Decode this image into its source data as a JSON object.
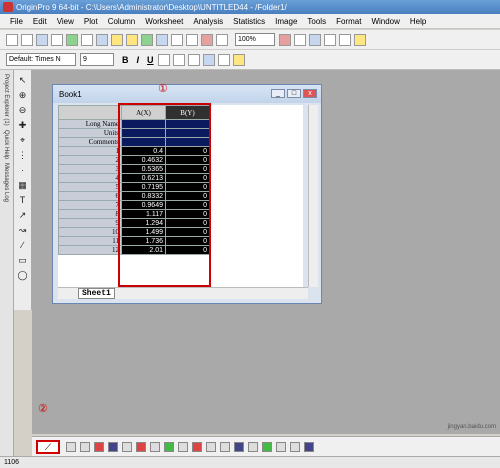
{
  "window": {
    "title": "OriginPro 9 64-bit - C:\\Users\\Administrator\\Desktop\\UNTITLED44 - /Folder1/"
  },
  "menu": [
    "File",
    "Edit",
    "View",
    "Plot",
    "Column",
    "Worksheet",
    "Analysis",
    "Statistics",
    "Image",
    "Tools",
    "Format",
    "Window",
    "Help"
  ],
  "toolbar": {
    "zoom": "100%",
    "font": "Default: Times N",
    "font_size": "9",
    "bold": "B",
    "italic": "I",
    "underline": "U"
  },
  "side_tabs": [
    "Project Explorer (1)",
    "Quick Help",
    "Messages Log"
  ],
  "book": {
    "title": "Book1",
    "columns": [
      "A(X)",
      "B(Y)"
    ],
    "row_labels": [
      "Long Name",
      "Units",
      "Comments"
    ],
    "rows": [
      {
        "n": "1",
        "a": "0.4",
        "b": "0"
      },
      {
        "n": "2",
        "a": "0.4632",
        "b": "0"
      },
      {
        "n": "3",
        "a": "0.5365",
        "b": "0"
      },
      {
        "n": "4",
        "a": "0.6213",
        "b": "0"
      },
      {
        "n": "5",
        "a": "0.7195",
        "b": "0"
      },
      {
        "n": "6",
        "a": "0.8332",
        "b": "0"
      },
      {
        "n": "7",
        "a": "0.9649",
        "b": "0"
      },
      {
        "n": "8",
        "a": "1.117",
        "b": "0"
      },
      {
        "n": "9",
        "a": "1.294",
        "b": "0"
      },
      {
        "n": "10",
        "a": "1.499",
        "b": "0"
      },
      {
        "n": "11",
        "a": "1.736",
        "b": "0"
      },
      {
        "n": "12",
        "a": "2.01",
        "b": "0"
      }
    ],
    "sheet_tab": "Sheet1"
  },
  "annotations": {
    "marker1": "①",
    "marker2": "②"
  },
  "status": {
    "left": "1106"
  },
  "watermark": "jingyan.baidu.com"
}
